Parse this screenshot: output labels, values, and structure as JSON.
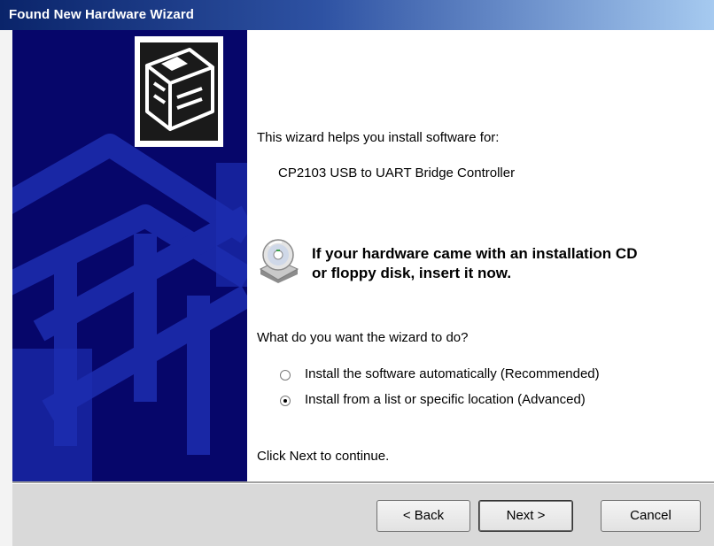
{
  "window": {
    "title": "Found New Hardware Wizard"
  },
  "wizard": {
    "intro": "This wizard helps you install software for:",
    "device_name": "CP2103 USB to UART Bridge Controller",
    "cd_notice_line1": "If your hardware came with an installation CD",
    "cd_notice_line2": "or floppy disk, insert it now.",
    "question": "What do you want the wizard to do?",
    "options": [
      {
        "label": "Install the software automatically (Recommended)",
        "selected": false
      },
      {
        "label": "Install from a list or specific location (Advanced)",
        "selected": true
      }
    ],
    "instruction": "Click Next to continue."
  },
  "buttons": {
    "back": "< Back",
    "next": "Next >",
    "cancel": "Cancel"
  },
  "colors": {
    "title_bar_start": "#0a246a",
    "side_panel": "#06066a",
    "footer": "#d9d9d9"
  },
  "icons": {
    "hardware_box": "hardware-box-icon",
    "cd": "cd-disc-icon"
  }
}
